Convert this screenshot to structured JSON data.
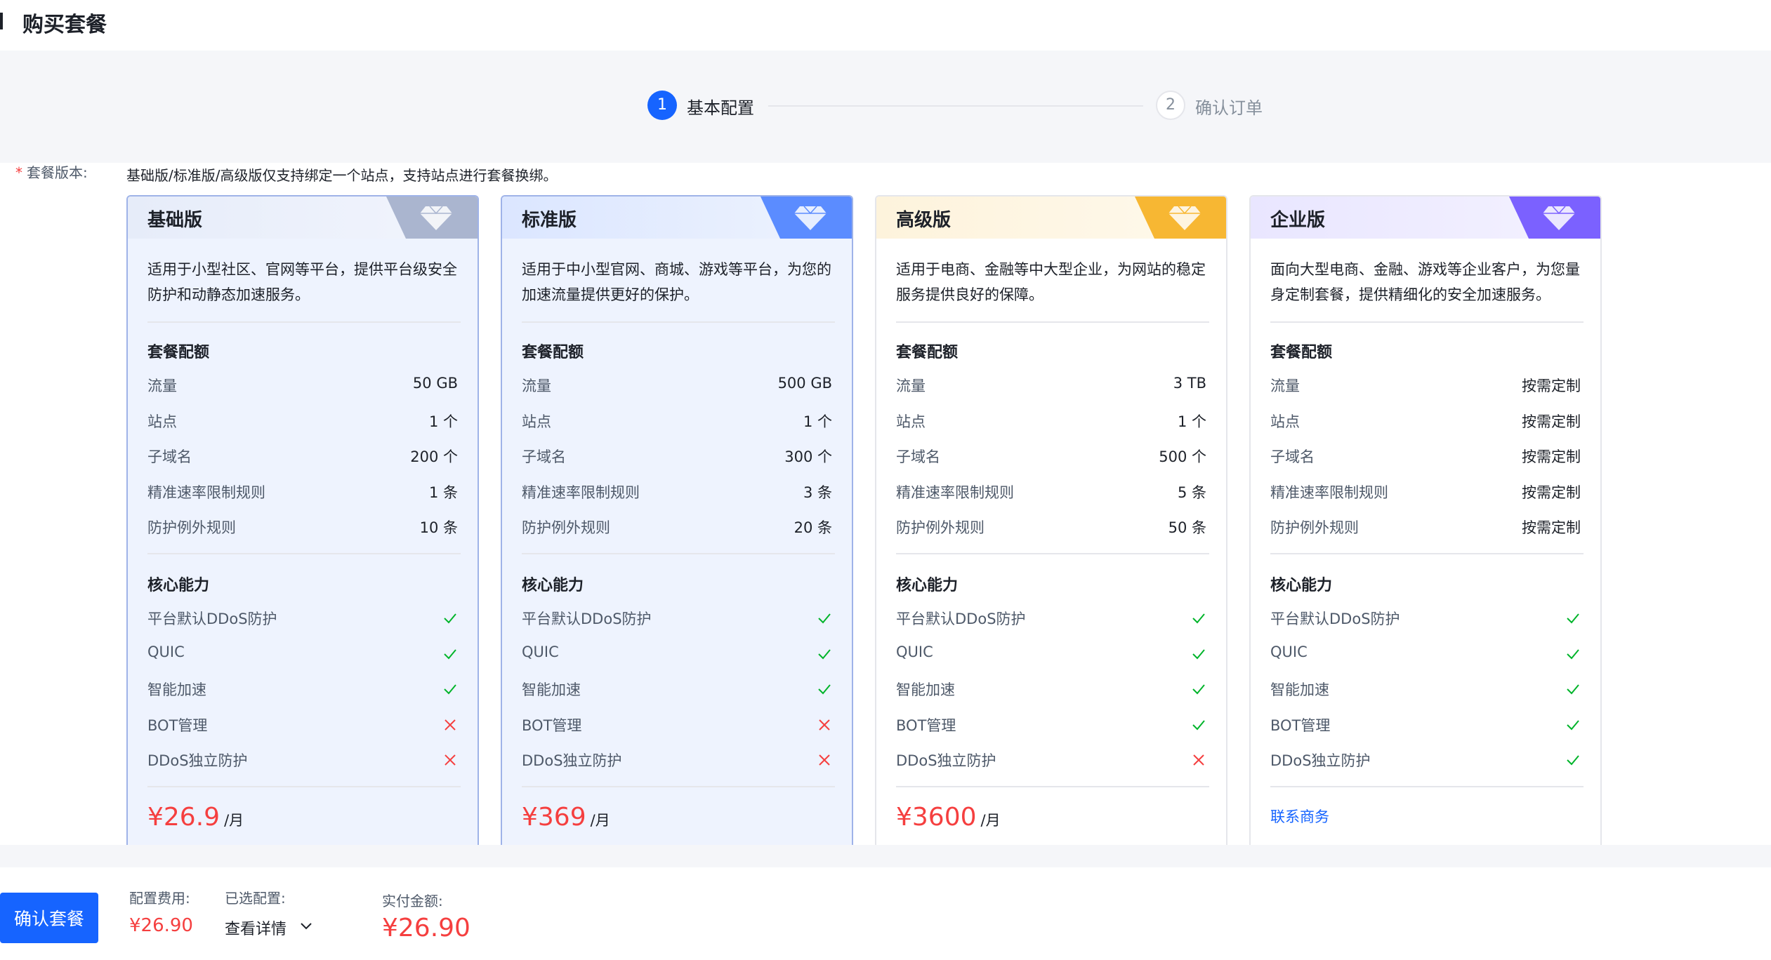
{
  "header": {
    "title": "购买套餐"
  },
  "steps": [
    {
      "number": "1",
      "label": "基本配置"
    },
    {
      "number": "2",
      "label": "确认订单"
    }
  ],
  "form": {
    "label": "套餐版本:",
    "hint": "基础版/标准版/高级版仅支持绑定一个站点，支持站点进行套餐换绑。"
  },
  "colors": {
    "primary": "#1664ff",
    "price": "#f53f3f",
    "check": "#00b42a",
    "cross": "#f53f3f",
    "badge_basic": "#aab5cf",
    "badge_standard": "#5b8cff",
    "badge_advanced": "#f7b733",
    "badge_enterprise": "#7b61ff"
  },
  "plans": [
    {
      "name": "基础版",
      "badge_icon": "diamond-icon",
      "desc": "适用于小型社区、官网等平台，提供平台级安全防护和动静态加速服务。",
      "quota_title": "套餐配额",
      "quotas": [
        {
          "label": "流量",
          "value": "50 GB"
        },
        {
          "label": "站点",
          "value": "1 个"
        },
        {
          "label": "子域名",
          "value": "200 个"
        },
        {
          "label": "精准速率限制规则",
          "value": "1 条"
        },
        {
          "label": "防护例外规则",
          "value": "10 条"
        }
      ],
      "feature_title": "核心能力",
      "features": [
        {
          "label": "平台默认DDoS防护",
          "icon": "check-icon"
        },
        {
          "label": "QUIC",
          "icon": "check-icon"
        },
        {
          "label": "智能加速",
          "icon": "check-icon"
        },
        {
          "label": "BOT管理",
          "icon": "cross-icon"
        },
        {
          "label": "DDoS独立防护",
          "icon": "cross-icon"
        }
      ],
      "price": "¥26.9",
      "unit": "/月"
    },
    {
      "name": "标准版",
      "badge_icon": "diamond-icon",
      "desc": "适用于中小型官网、商城、游戏等平台，为您的加速流量提供更好的保护。",
      "quota_title": "套餐配额",
      "quotas": [
        {
          "label": "流量",
          "value": "500 GB"
        },
        {
          "label": "站点",
          "value": "1 个"
        },
        {
          "label": "子域名",
          "value": "300 个"
        },
        {
          "label": "精准速率限制规则",
          "value": "3 条"
        },
        {
          "label": "防护例外规则",
          "value": "20 条"
        }
      ],
      "feature_title": "核心能力",
      "features": [
        {
          "label": "平台默认DDoS防护",
          "icon": "check-icon"
        },
        {
          "label": "QUIC",
          "icon": "check-icon"
        },
        {
          "label": "智能加速",
          "icon": "check-icon"
        },
        {
          "label": "BOT管理",
          "icon": "cross-icon"
        },
        {
          "label": "DDoS独立防护",
          "icon": "cross-icon"
        }
      ],
      "price": "¥369",
      "unit": "/月"
    },
    {
      "name": "高级版",
      "badge_icon": "diamond-icon",
      "desc": "适用于电商、金融等中大型企业，为网站的稳定服务提供良好的保障。",
      "quota_title": "套餐配额",
      "quotas": [
        {
          "label": "流量",
          "value": "3 TB"
        },
        {
          "label": "站点",
          "value": "1 个"
        },
        {
          "label": "子域名",
          "value": "500 个"
        },
        {
          "label": "精准速率限制规则",
          "value": "5 条"
        },
        {
          "label": "防护例外规则",
          "value": "50 条"
        }
      ],
      "feature_title": "核心能力",
      "features": [
        {
          "label": "平台默认DDoS防护",
          "icon": "check-icon"
        },
        {
          "label": "QUIC",
          "icon": "check-icon"
        },
        {
          "label": "智能加速",
          "icon": "check-icon"
        },
        {
          "label": "BOT管理",
          "icon": "check-icon"
        },
        {
          "label": "DDoS独立防护",
          "icon": "cross-icon"
        }
      ],
      "price": "¥3600",
      "unit": "/月"
    },
    {
      "name": "企业版",
      "badge_icon": "diamond-icon",
      "desc": "面向大型电商、金融、游戏等企业客户，为您量身定制套餐，提供精细化的安全加速服务。",
      "quota_title": "套餐配额",
      "quotas": [
        {
          "label": "流量",
          "value": "按需定制"
        },
        {
          "label": "站点",
          "value": "按需定制"
        },
        {
          "label": "子域名",
          "value": "按需定制"
        },
        {
          "label": "精准速率限制规则",
          "value": "按需定制"
        },
        {
          "label": "防护例外规则",
          "value": "按需定制"
        }
      ],
      "feature_title": "核心能力",
      "features": [
        {
          "label": "平台默认DDoS防护",
          "icon": "check-icon"
        },
        {
          "label": "QUIC",
          "icon": "check-icon"
        },
        {
          "label": "智能加速",
          "icon": "check-icon"
        },
        {
          "label": "BOT管理",
          "icon": "check-icon"
        },
        {
          "label": "DDoS独立防护",
          "icon": "check-icon"
        }
      ],
      "contact": "联系商务"
    }
  ],
  "footer": {
    "confirm_label": "确认套餐",
    "config_fee_label": "配置费用:",
    "config_fee_value": "¥26.90",
    "selected_label": "已选配置:",
    "detail_label": "查看详情",
    "paid_label": "实付金额:",
    "paid_value": "¥26.90"
  }
}
